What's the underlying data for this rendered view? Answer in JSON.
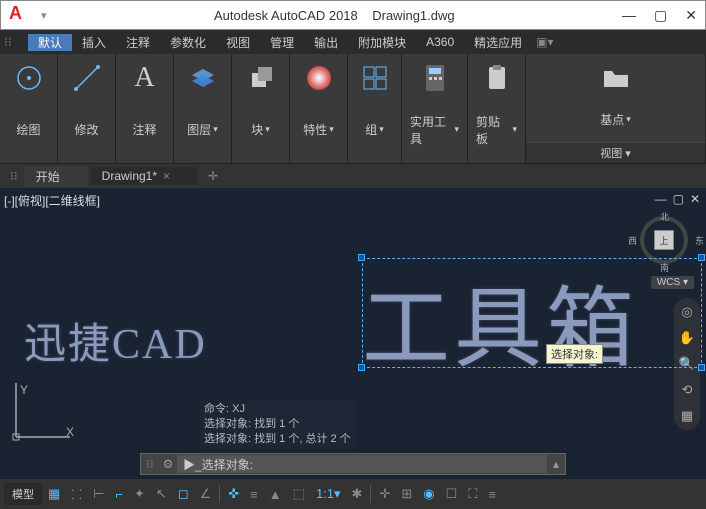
{
  "title": {
    "app": "Autodesk AutoCAD 2018",
    "file": "Drawing1.dwg"
  },
  "menu": {
    "items": [
      "默认",
      "插入",
      "注释",
      "参数化",
      "视图",
      "管理",
      "输出",
      "附加模块",
      "A360",
      "精选应用"
    ]
  },
  "ribbon": {
    "panels": [
      {
        "label": "绘图"
      },
      {
        "label": "修改"
      },
      {
        "label": "注释"
      },
      {
        "label": "图层"
      },
      {
        "label": "块"
      },
      {
        "label": "特性"
      },
      {
        "label": "组"
      },
      {
        "label": "实用工具"
      },
      {
        "label": "剪贴板"
      },
      {
        "label": "基点"
      }
    ],
    "footer": "视图 ▾"
  },
  "tabs": {
    "start": "开始",
    "doc": "Drawing1*"
  },
  "viewport": {
    "label": "[-][俯视][二维线框]",
    "text1": "迅捷CAD",
    "text2": "工具箱",
    "tooltip": "选择对象:",
    "wcs": "WCS ▾",
    "cube": {
      "face": "上",
      "n": "北",
      "s": "南",
      "e": "东",
      "w": "西"
    },
    "ucs": {
      "y": "Y",
      "x": "X"
    }
  },
  "cmd": {
    "log": [
      "命令: XJ",
      "选择对象: 找到 1 个",
      "选择对象: 找到 1 个, 总计 2 个"
    ],
    "prompt": "▶_选择对象:"
  },
  "status": {
    "model": "模型",
    "scale": "1:1"
  }
}
